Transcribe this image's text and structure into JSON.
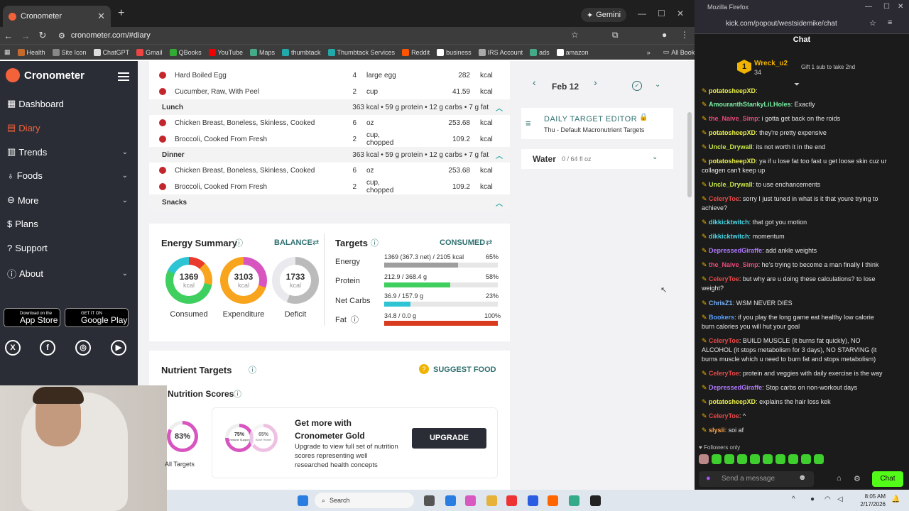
{
  "chrome": {
    "tab_title": "Cronometer",
    "gemini_label": "Gemini",
    "url": "cronometer.com/#diary",
    "bookmarks": [
      "Health",
      "Site Icon",
      "ChatGPT",
      "Gmail",
      "QBooks",
      "YouTube",
      "Maps",
      "thumbtack",
      "Thumbtack Services",
      "Reddit",
      "business",
      "IRS Account",
      "ads",
      "amazon"
    ],
    "all_bookmarks": "All Bookmarks"
  },
  "sidebar": {
    "brand": "Cronometer",
    "items": [
      {
        "label": "Dashboard"
      },
      {
        "label": "Diary"
      },
      {
        "label": "Trends"
      },
      {
        "label": "Foods"
      },
      {
        "label": "More"
      },
      {
        "label": "Plans"
      },
      {
        "label": "Support"
      },
      {
        "label": "About"
      }
    ],
    "app_store_small": "Download on the",
    "app_store": "App Store",
    "google_play_small": "GET IT ON",
    "google_play": "Google Play"
  },
  "diary": {
    "top_rows": [
      {
        "name": "Hard Boiled Egg",
        "qty": "4",
        "unit": "large egg",
        "value": "282",
        "kcal": "kcal"
      },
      {
        "name": "Cucumber, Raw, With Peel",
        "qty": "2",
        "unit": "cup",
        "value": "41.59",
        "kcal": "kcal"
      }
    ],
    "lunch": {
      "label": "Lunch",
      "summary": "363 kcal • 59 g protein • 12 g carbs • 7 g fat"
    },
    "lunch_rows": [
      {
        "name": "Chicken Breast, Boneless, Skinless, Cooked",
        "qty": "6",
        "unit": "oz",
        "value": "253.68",
        "kcal": "kcal"
      },
      {
        "name": "Broccoli, Cooked From Fresh",
        "qty": "2",
        "unit": "cup, chopped",
        "value": "109.2",
        "kcal": "kcal"
      }
    ],
    "dinner": {
      "label": "Dinner",
      "summary": "363 kcal • 59 g protein • 12 g carbs • 7 g fat"
    },
    "dinner_rows": [
      {
        "name": "Chicken Breast, Boneless, Skinless, Cooked",
        "qty": "6",
        "unit": "oz",
        "value": "253.68",
        "kcal": "kcal"
      },
      {
        "name": "Broccoli, Cooked From Fresh",
        "qty": "2",
        "unit": "cup, chopped",
        "value": "109.2",
        "kcal": "kcal"
      }
    ],
    "snacks": "Snacks"
  },
  "right_panel": {
    "date": "Feb 12",
    "target_editor_title": "DAILY TARGET EDITOR",
    "target_editor_sub": "Thu - Default Macronutrient Targets",
    "water_label": "Water",
    "water_value": "0 / 64 fl oz"
  },
  "energy": {
    "title": "Energy Summary",
    "balance": "BALANCE",
    "consumed_val": "1369",
    "consumed_unit": "kcal",
    "consumed_label": "Consumed",
    "expenditure_val": "3103",
    "expenditure_unit": "kcal",
    "expenditure_label": "Expenditure",
    "deficit_val": "1733",
    "deficit_unit": "kcal",
    "deficit_label": "Deficit"
  },
  "targets": {
    "title": "Targets",
    "consumed": "CONSUMED",
    "items": [
      {
        "label": "Energy",
        "value": "1369 (367.3 net) / 2105 kcal",
        "pct": "65%",
        "fill": 0.65,
        "color": "#9e9e9e"
      },
      {
        "label": "Protein",
        "value": "212.9 / 368.4 g",
        "pct": "58%",
        "fill": 0.58,
        "color": "#3ecf5e"
      },
      {
        "label": "Net Carbs",
        "value": "36.9 / 157.9 g",
        "pct": "23%",
        "fill": 0.23,
        "color": "#2ec4d4"
      },
      {
        "label": "Fat",
        "value": "34.8 / 0.0 g",
        "pct": "100%",
        "fill": 1.0,
        "color": "#d83b1e"
      }
    ]
  },
  "nutrients": {
    "title": "Nutrient Targets",
    "suggest": "SUGGEST FOOD",
    "scores_title": "Nutrition Scores",
    "all_targets_pct": "83%",
    "all_targets_label": "All Targets",
    "immune_pct": "75%",
    "immune_label": "Immune Support",
    "bone_pct": "65%",
    "bone_label": "Bone Health",
    "gold_title_1": "Get more with",
    "gold_title_2": "Cronometer Gold",
    "gold_body": "Upgrade to view full set of nutrition scores representing well researched health concepts",
    "upgrade": "UPGRADE"
  },
  "chat": {
    "ff_title": "Mozilla Firefox",
    "ff_url": "kick.com/popout/westsidemike/chat",
    "header": "Chat",
    "gifter": "Wreck_u2",
    "gifter_count": "34",
    "gift_text": "Gift 1 sub to take 2nd",
    "messages": [
      {
        "user": "potatosheepXD",
        "text": ""
      },
      {
        "user": "AmouranthStankyLiLHoles",
        "text": "Exactly"
      },
      {
        "user": "the_Naive_Simp",
        "text": "i gotta get back on the roids"
      },
      {
        "user": "potatosheepXD",
        "text": "they're pretty expensive"
      },
      {
        "user": "Uncle_Drywall",
        "text": "its not worth it in the end"
      },
      {
        "user": "potatosheepXD",
        "text": "ya if u lose fat too fast u get loose skin cuz ur collagen can't keep up"
      },
      {
        "user": "Uncle_Drywall",
        "text": "to use enchancements"
      },
      {
        "user": "CeleryToe",
        "text": "sorry I just tuned in what is it that youre trying to achieve?"
      },
      {
        "user": "dikkicktwitch",
        "text": "that got you motion"
      },
      {
        "user": "dikkicktwitch",
        "text": "momentum"
      },
      {
        "user": "DepressedGiraffe",
        "text": "add ankle weights"
      },
      {
        "user": "the_Naive_Simp",
        "text": "he's trying to become a man finally I think"
      },
      {
        "user": "CeleryToe",
        "text": "but why are u doing these calculations? to lose weight?"
      },
      {
        "user": "ChrisZ1",
        "text": "WSM NEVER DIES"
      },
      {
        "user": "Bookers",
        "text": "if you play the long game eat healthy low calorie burn calories you will hut your goal"
      },
      {
        "user": "CeleryToe",
        "text": "BUILD MUSCLE (it burns fat quickly), NO ALCOHOL (it stops metabolism for 3 days), NO STARVING (it burns muscle which u need to burn fat and stops metabolism)"
      },
      {
        "user": "CeleryToe",
        "text": "protein and veggies with daily exercise is the way"
      },
      {
        "user": "DepressedGiraffe",
        "text": "Stop carbs on non-workout days"
      },
      {
        "user": "potatosheepXD",
        "text": "explains the hair loss kek"
      },
      {
        "user": "CeleryToe",
        "text": "^"
      },
      {
        "user": "slysii",
        "text": "soi af"
      }
    ],
    "followers_only": "Followers only",
    "send_placeholder": "Send a message",
    "chat_button": "Chat"
  },
  "taskbar": {
    "search": "Search",
    "time": "8:05 AM",
    "date": "2/17/2026"
  }
}
